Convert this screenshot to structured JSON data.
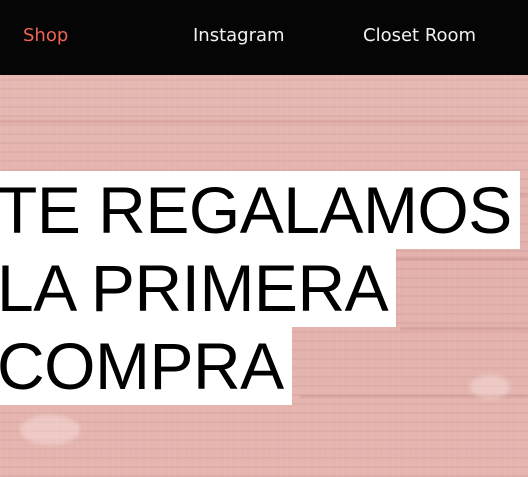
{
  "nav": {
    "items": [
      {
        "label": "Shop",
        "active": true
      },
      {
        "label": "Instagram",
        "active": false
      },
      {
        "label": "Closet Room",
        "active": false
      }
    ],
    "background": "#050505",
    "text_color": "#f2f2f2",
    "active_color": "#f0645a"
  },
  "hero": {
    "headline_lines": [
      "TE REGALAMOS",
      "LA PRIMERA",
      "COMPRA"
    ],
    "background_color": "#e6b3ae",
    "highlight_color": "#ffffff"
  }
}
